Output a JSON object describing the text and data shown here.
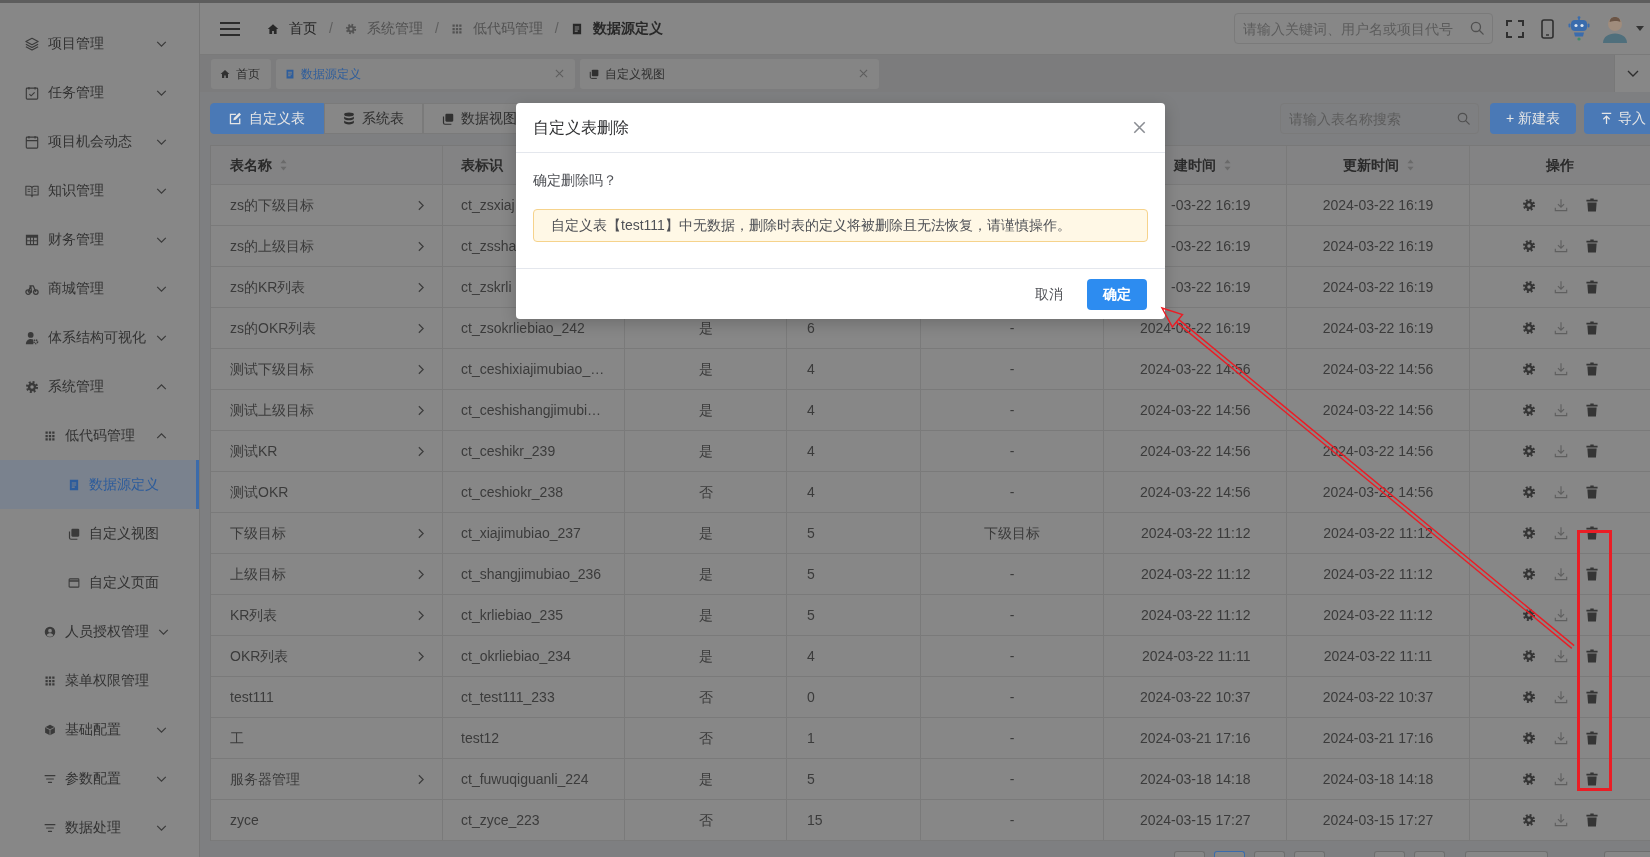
{
  "sidebar": {
    "items": [
      {
        "label": "项目管理",
        "expanded": false,
        "selected": false
      },
      {
        "label": "任务管理",
        "expanded": false,
        "selected": false
      },
      {
        "label": "项目机会动态",
        "expanded": false,
        "selected": false
      },
      {
        "label": "知识管理",
        "expanded": false,
        "selected": false
      },
      {
        "label": "财务管理",
        "expanded": false,
        "selected": false
      },
      {
        "label": "商城管理",
        "expanded": false,
        "selected": false
      },
      {
        "label": "体系结构可视化",
        "expanded": false,
        "selected": false
      },
      {
        "label": "系统管理",
        "expanded": true,
        "selected": false,
        "children": [
          {
            "label": "低代码管理",
            "expanded": true,
            "selected": false,
            "children": [
              {
                "label": "数据源定义",
                "selected": true
              },
              {
                "label": "自定义视图",
                "selected": false
              },
              {
                "label": "自定义页面",
                "selected": false
              }
            ]
          },
          {
            "label": "人员授权管理",
            "expanded": false,
            "selected": false
          },
          {
            "label": "菜单权限管理",
            "selected": false
          },
          {
            "label": "基础配置",
            "expanded": false,
            "selected": false
          },
          {
            "label": "参数配置",
            "expanded": false,
            "selected": false
          },
          {
            "label": "数据处理",
            "expanded": false,
            "selected": false
          }
        ]
      }
    ]
  },
  "header": {
    "breadcrumb": {
      "separator": "/",
      "items": [
        {
          "label": "首页",
          "dimmed": false,
          "current": false
        },
        {
          "label": "系统管理",
          "dimmed": true,
          "current": false
        },
        {
          "label": "低代码管理",
          "dimmed": true,
          "current": false
        },
        {
          "label": "数据源定义",
          "dimmed": false,
          "current": true
        }
      ]
    },
    "search": {
      "placeholder": "请输入关键词、用户名或项目代号"
    }
  },
  "tabs": [
    {
      "label": "首页",
      "selected": false,
      "closable": false
    },
    {
      "label": "数据源定义",
      "selected": true,
      "closable": true
    },
    {
      "label": "自定义视图",
      "selected": false,
      "closable": true
    }
  ],
  "toolbar": {
    "segments": [
      {
        "label": "自定义表",
        "selected": true
      },
      {
        "label": "系统表",
        "selected": false
      },
      {
        "label": "数据视图",
        "selected": false
      }
    ],
    "search": {
      "placeholder": "请输入表名称搜索"
    },
    "buttons": [
      {
        "label": "+ 新建表",
        "kind": "create"
      },
      {
        "label": "导入",
        "kind": "import"
      }
    ]
  },
  "table": {
    "columns": {
      "name": {
        "label": "表名称",
        "sortable": true
      },
      "table_id": {
        "label": "表标识"
      },
      "created": {
        "label": "建时间",
        "sortable": true
      },
      "updated": {
        "label": "更新时间",
        "sortable": true
      },
      "actions": {
        "label": "操作"
      }
    },
    "rows": [
      {
        "name": "zs的下级目标",
        "expandable": true,
        "table_id": "ct_zsxiaj",
        "created": "-03-22 16:19",
        "updated": "2024-03-22 16:19"
      },
      {
        "name": "zs的上级目标",
        "expandable": true,
        "table_id": "ct_zssha",
        "created": "-03-22 16:19",
        "updated": "2024-03-22 16:19"
      },
      {
        "name": "zs的KR列表",
        "expandable": true,
        "table_id": "ct_zskrli",
        "created": "-03-22 16:19",
        "updated": "2024-03-22 16:19"
      },
      {
        "name": "zs的OKR列表",
        "expandable": true,
        "table_id": "ct_zsokrliebiao_242",
        "column_3": "是",
        "column_4": "6",
        "column_5": "-",
        "created": "2024-03-22 16:19",
        "updated": "2024-03-22 16:19"
      },
      {
        "name": "测试下级目标",
        "expandable": true,
        "table_id": "ct_ceshixiajimubiao_…",
        "column_3": "是",
        "column_4": "4",
        "column_5": "-",
        "created": "2024-03-22 14:56",
        "updated": "2024-03-22 14:56"
      },
      {
        "name": "测试上级目标",
        "expandable": true,
        "table_id": "ct_ceshishangjimubi…",
        "column_3": "是",
        "column_4": "4",
        "column_5": "-",
        "created": "2024-03-22 14:56",
        "updated": "2024-03-22 14:56"
      },
      {
        "name": "测试KR",
        "expandable": true,
        "table_id": "ct_ceshikr_239",
        "column_3": "是",
        "column_4": "4",
        "column_5": "-",
        "created": "2024-03-22 14:56",
        "updated": "2024-03-22 14:56"
      },
      {
        "name": "测试OKR",
        "expandable": false,
        "table_id": "ct_ceshiokr_238",
        "column_3": "否",
        "column_4": "4",
        "column_5": "-",
        "created": "2024-03-22 14:56",
        "updated": "2024-03-22 14:56"
      },
      {
        "name": "下级目标",
        "expandable": true,
        "table_id": "ct_xiajimubiao_237",
        "column_3": "是",
        "column_4": "5",
        "column_5": "下级目标",
        "created": "2024-03-22 11:12",
        "updated": "2024-03-22 11:12"
      },
      {
        "name": "上级目标",
        "expandable": true,
        "table_id": "ct_shangjimubiao_236",
        "column_3": "是",
        "column_4": "5",
        "column_5": "-",
        "created": "2024-03-22 11:12",
        "updated": "2024-03-22 11:12"
      },
      {
        "name": "KR列表",
        "expandable": true,
        "table_id": "ct_krliebiao_235",
        "column_3": "是",
        "column_4": "5",
        "column_5": "-",
        "created": "2024-03-22 11:12",
        "updated": "2024-03-22 11:12"
      },
      {
        "name": "OKR列表",
        "expandable": true,
        "table_id": "ct_okrliebiao_234",
        "column_3": "是",
        "column_4": "4",
        "column_5": "-",
        "created": "2024-03-22 11:11",
        "updated": "2024-03-22 11:11"
      },
      {
        "name": "test111",
        "expandable": false,
        "table_id": "ct_test111_233",
        "column_3": "否",
        "column_4": "0",
        "column_5": "-",
        "created": "2024-03-22 10:37",
        "updated": "2024-03-22 10:37"
      },
      {
        "name": "工",
        "expandable": false,
        "table_id": "test12",
        "column_3": "否",
        "column_4": "1",
        "column_5": "-",
        "created": "2024-03-21 17:16",
        "updated": "2024-03-21 17:16"
      },
      {
        "name": "服务器管理",
        "expandable": true,
        "table_id": "ct_fuwuqiguanli_224",
        "column_3": "是",
        "column_4": "5",
        "column_5": "-",
        "created": "2024-03-18 14:18",
        "updated": "2024-03-18 14:18"
      },
      {
        "name": "zyce",
        "expandable": false,
        "table_id": "ct_zyce_223",
        "column_3": "否",
        "column_4": "15",
        "column_5": "-",
        "created": "2024-03-15 17:27",
        "updated": "2024-03-15 17:27"
      }
    ]
  },
  "pagination": [
    {
      "kind": "page",
      "selected": false
    },
    {
      "kind": "page",
      "selected": true
    },
    {
      "kind": "page",
      "selected": false
    },
    {
      "kind": "page",
      "selected": false
    },
    {
      "kind": "page",
      "selected": false
    },
    {
      "kind": "page",
      "selected": false
    },
    {
      "kind": "select",
      "selected": false
    },
    {
      "kind": "jump",
      "selected": false
    }
  ],
  "modal": {
    "title": "自定义表删除",
    "message": "确定删除吗？",
    "alert": "自定义表【test111】中无数据，删除时表的定义将被删除且无法恢复，请谨慎操作。",
    "buttons": [
      {
        "label": "取消",
        "kind": "text"
      },
      {
        "label": "确定",
        "kind": "primary"
      }
    ]
  },
  "annotations": [
    {
      "kind": "rectangle"
    },
    {
      "kind": "arrow"
    }
  ]
}
